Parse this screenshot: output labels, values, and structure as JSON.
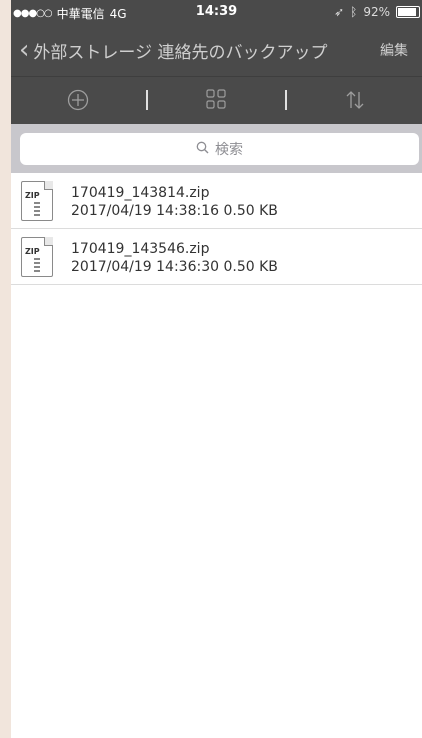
{
  "statusbar": {
    "carrier": "中華電信",
    "network": "4G",
    "signal_dots": "●●●○○",
    "time": "14:39",
    "battery_percent": "92%",
    "battery_level": 0.92
  },
  "navbar": {
    "back_icon": "chevron-left-icon",
    "title": "外部ストレージ 連絡先のバックアップ",
    "edit_label": "編集"
  },
  "toolbar": {
    "items": [
      "add-circle-icon",
      "grid-icon",
      "sort-icon"
    ]
  },
  "search": {
    "placeholder": "検索"
  },
  "files": [
    {
      "name": "170419_143814.zip",
      "meta": "2017/04/19 14:38:16  0.50 KB",
      "icon_label": "ZIP"
    },
    {
      "name": "170419_143546.zip",
      "meta": "2017/04/19 14:36:30  0.50 KB",
      "icon_label": "ZIP"
    }
  ],
  "colors": {
    "bar_background": "#4a4a4a",
    "search_background": "#c8c7cc",
    "page_background": "#f1e5dc"
  }
}
